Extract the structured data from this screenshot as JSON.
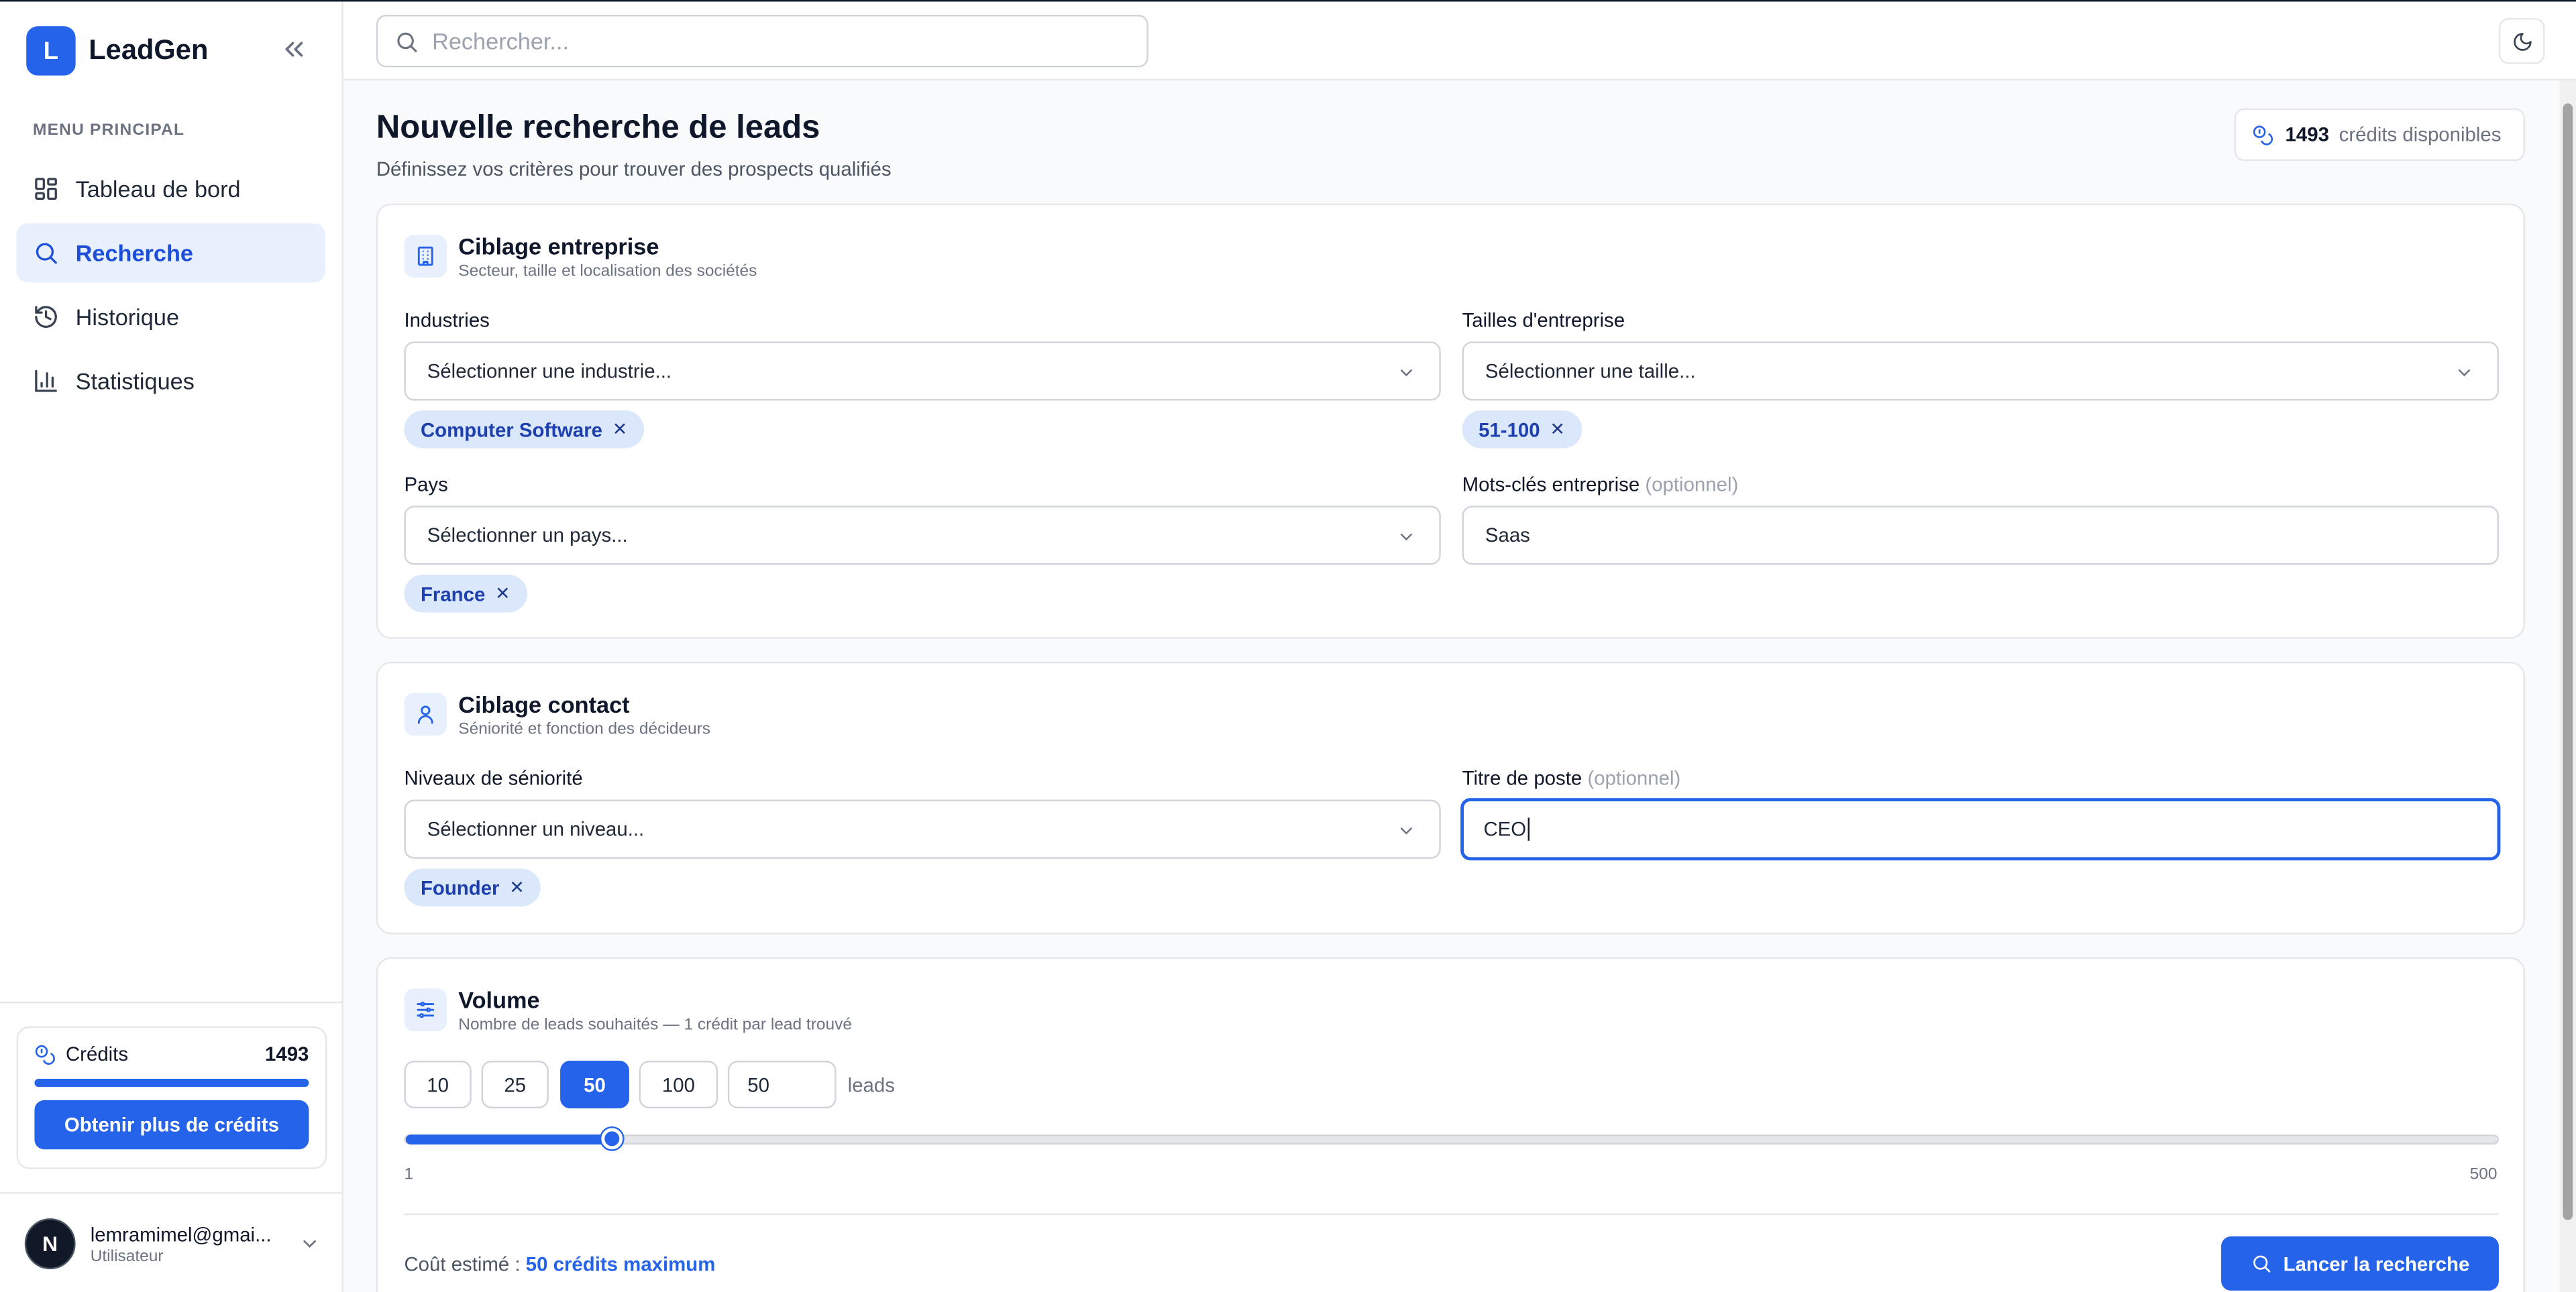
{
  "app": {
    "logo_letter": "L",
    "name": "LeadGen"
  },
  "sidebar": {
    "menu_label": "MENU PRINCIPAL",
    "items": [
      {
        "label": "Tableau de bord",
        "icon": "layout-dashboard-icon",
        "active": false
      },
      {
        "label": "Recherche",
        "icon": "search-icon",
        "active": true
      },
      {
        "label": "Historique",
        "icon": "history-icon",
        "active": false
      },
      {
        "label": "Statistiques",
        "icon": "bar-chart-icon",
        "active": false
      }
    ],
    "credits": {
      "label": "Crédits",
      "value": "1493",
      "progress_percent": 100,
      "button": "Obtenir plus de crédits"
    },
    "user": {
      "avatar_letter": "N",
      "email": "lemramimel@gmai...",
      "role": "Utilisateur"
    }
  },
  "topbar": {
    "search_placeholder": "Rechercher..."
  },
  "page": {
    "title": "Nouvelle recherche de leads",
    "subtitle": "Définissez vos critères pour trouver des prospects qualifiés",
    "credits_value": "1493",
    "credits_label": "crédits disponibles"
  },
  "company": {
    "title": "Ciblage entreprise",
    "subtitle": "Secteur, taille et localisation des sociétés",
    "industries_label": "Industries",
    "industries_placeholder": "Sélectionner une industrie...",
    "industries_chip": "Computer Software",
    "sizes_label": "Tailles d'entreprise",
    "sizes_placeholder": "Sélectionner une taille...",
    "sizes_chip": "51-100",
    "country_label": "Pays",
    "country_placeholder": "Sélectionner un pays...",
    "country_chip": "France",
    "keywords_label": "Mots-clés entreprise",
    "keywords_optional": "(optionnel)",
    "keywords_value": "Saas"
  },
  "contact": {
    "title": "Ciblage contact",
    "subtitle": "Séniorité et fonction des décideurs",
    "seniority_label": "Niveaux de séniorité",
    "seniority_placeholder": "Sélectionner un niveau...",
    "seniority_chip": "Founder",
    "job_label": "Titre de poste",
    "job_optional": "(optionnel)",
    "job_value": "CEO"
  },
  "volume": {
    "title": "Volume",
    "subtitle": "Nombre de leads souhaités — 1 crédit par lead trouvé",
    "presets": [
      "10",
      "25",
      "50",
      "100"
    ],
    "selected": "50",
    "custom_value": "50",
    "unit": "leads",
    "slider_min": "1",
    "slider_max": "500",
    "slider_value": 50,
    "cost_label": "Coût estimé :",
    "cost_value": "50 crédits maximum",
    "launch_button": "Lancer la recherche"
  },
  "colors": {
    "accent": "#2563eb",
    "accent_light": "#e8f0fe",
    "chip_bg": "#dbe7fb"
  }
}
